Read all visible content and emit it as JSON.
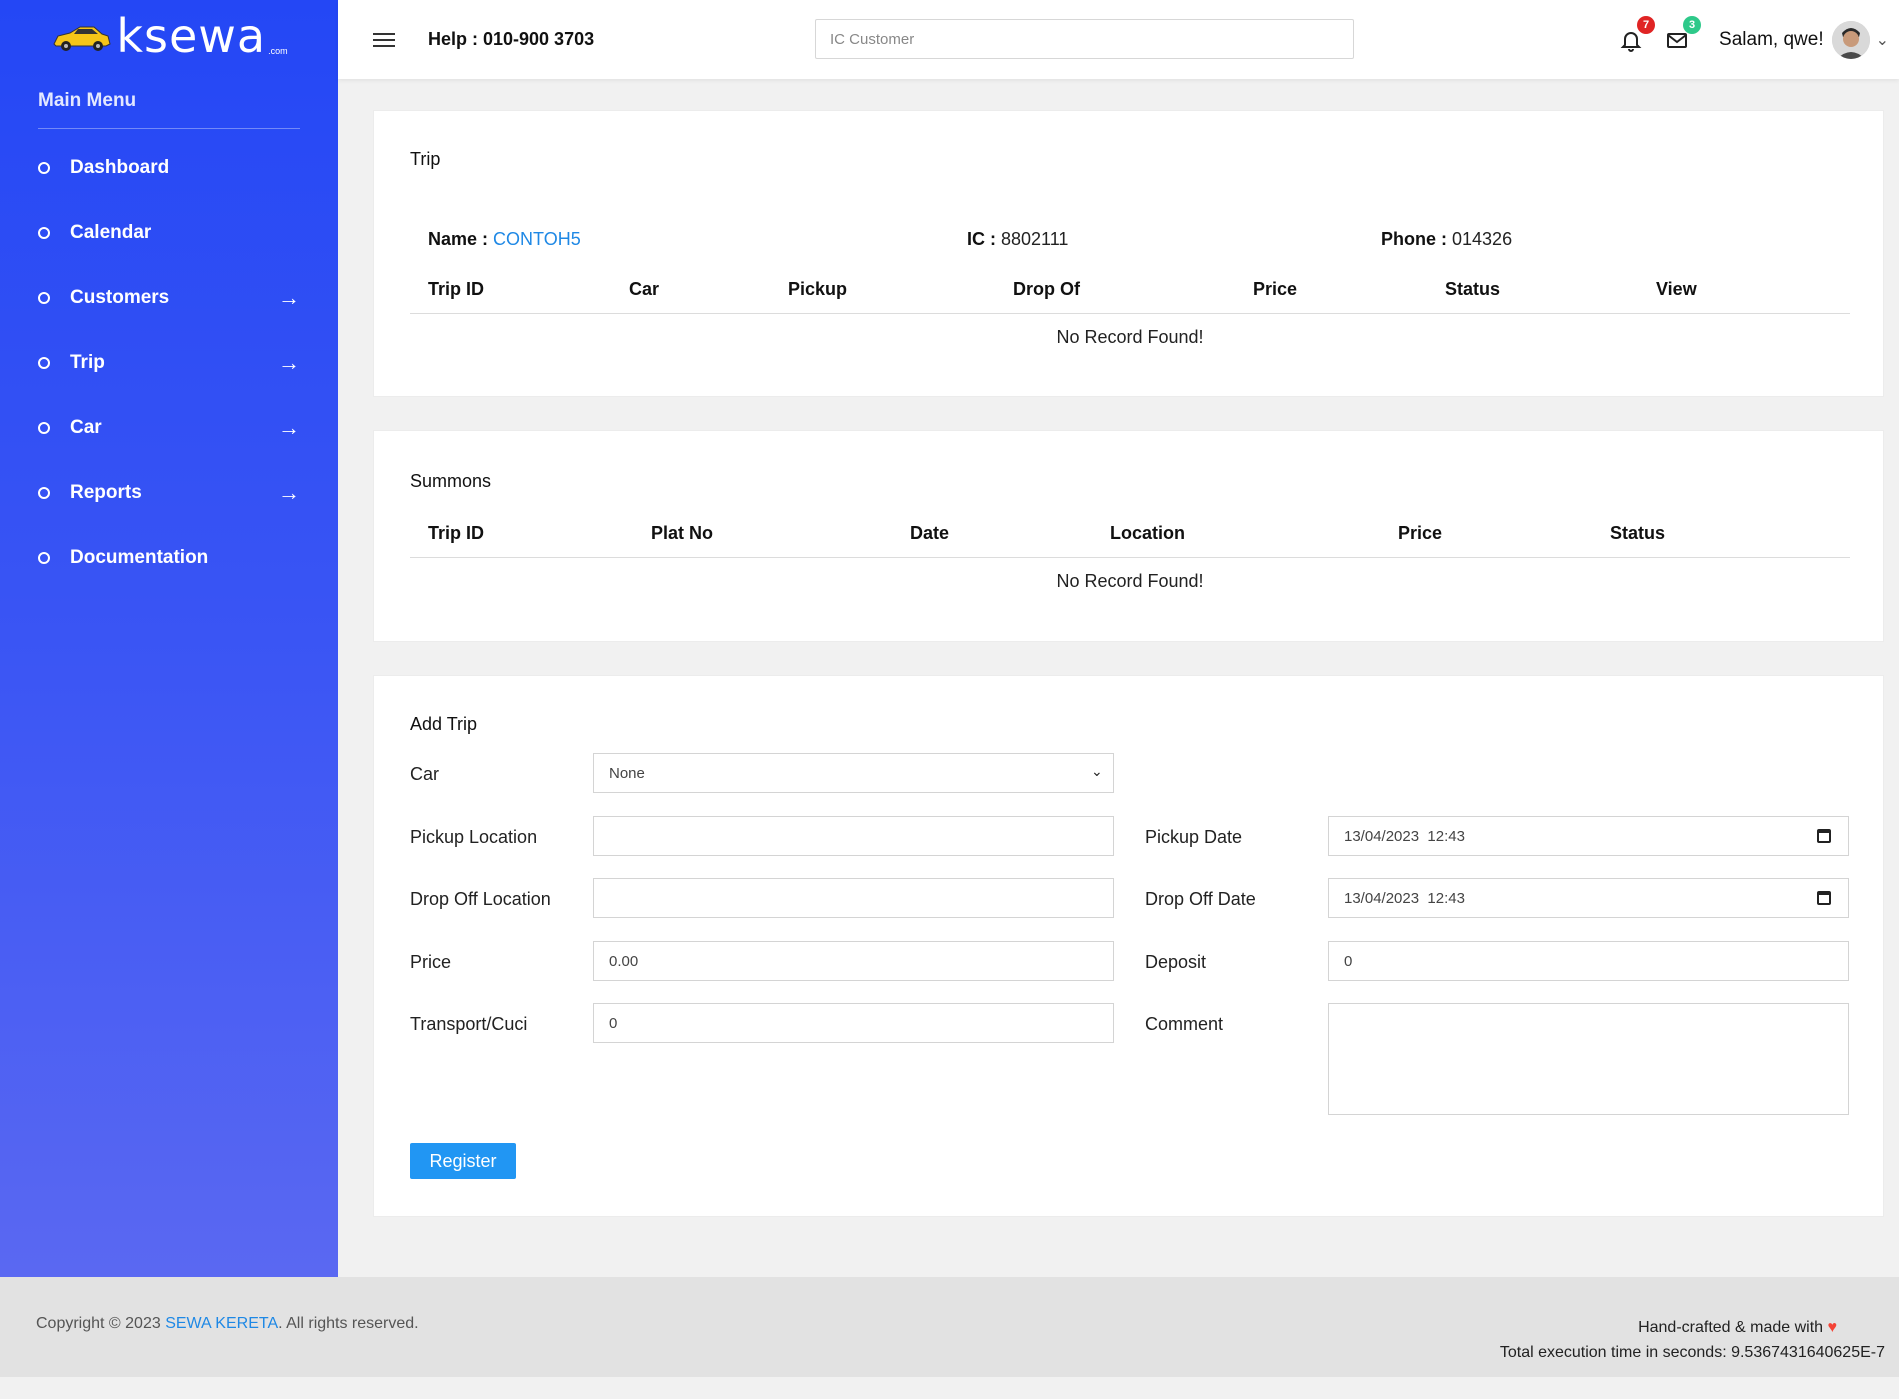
{
  "brand": {
    "name": "ksewa",
    "suffix": ".com"
  },
  "sidebar": {
    "title": "Main Menu",
    "items": [
      {
        "label": "Dashboard",
        "has_arrow": false
      },
      {
        "label": "Calendar",
        "has_arrow": false
      },
      {
        "label": "Customers",
        "has_arrow": true
      },
      {
        "label": "Trip",
        "has_arrow": true
      },
      {
        "label": "Car",
        "has_arrow": true
      },
      {
        "label": "Reports",
        "has_arrow": true
      },
      {
        "label": "Documentation",
        "has_arrow": false
      }
    ]
  },
  "topbar": {
    "help": "Help : 010-900 3703",
    "search_placeholder": "IC Customer",
    "notifications_count": "7",
    "messages_count": "3",
    "greeting": "Salam, qwe!"
  },
  "trip_card": {
    "title": "Trip",
    "name_label": "Name :",
    "name_value": "CONTOH5",
    "ic_label": "IC :",
    "ic_value": "8802111",
    "phone_label": "Phone :",
    "phone_value": "014326",
    "columns": [
      "Trip ID",
      "Car",
      "Pickup",
      "Drop Of",
      "Price",
      "Status",
      "View"
    ],
    "empty": "No Record Found!"
  },
  "summons_card": {
    "title": "Summons",
    "columns": [
      "Trip ID",
      "Plat No",
      "Date",
      "Location",
      "Price",
      "Status"
    ],
    "empty": "No Record Found!"
  },
  "add_trip": {
    "title": "Add Trip",
    "car_label": "Car",
    "car_value": "None",
    "pickup_location_label": "Pickup Location",
    "pickup_location_value": "",
    "pickup_date_label": "Pickup Date",
    "pickup_date_value": "13/04/2023  12:43",
    "dropoff_location_label": "Drop Off Location",
    "dropoff_location_value": "",
    "dropoff_date_label": "Drop Off Date",
    "dropoff_date_value": "13/04/2023  12:43",
    "price_label": "Price",
    "price_value": "0.00",
    "deposit_label": "Deposit",
    "deposit_value": "0",
    "transport_label": "Transport/Cuci",
    "transport_value": "0",
    "comment_label": "Comment",
    "comment_value": "",
    "register_label": "Register"
  },
  "footer": {
    "copyright_prefix": "Copyright © 2023 ",
    "company": "SEWA KERETA",
    "copyright_suffix": ". All rights reserved.",
    "made_with": "Hand-crafted & made with",
    "execution_time": "Total execution time in seconds: 9.5367431640625E-7"
  },
  "colors": {
    "sidebar_top": "#2447f5",
    "sidebar_bottom": "#5a68f2",
    "link": "#1e88e5",
    "button": "#2196f3",
    "badge_red": "#e02424",
    "badge_green": "#2ec98a",
    "logo_car": "#f5c518"
  }
}
